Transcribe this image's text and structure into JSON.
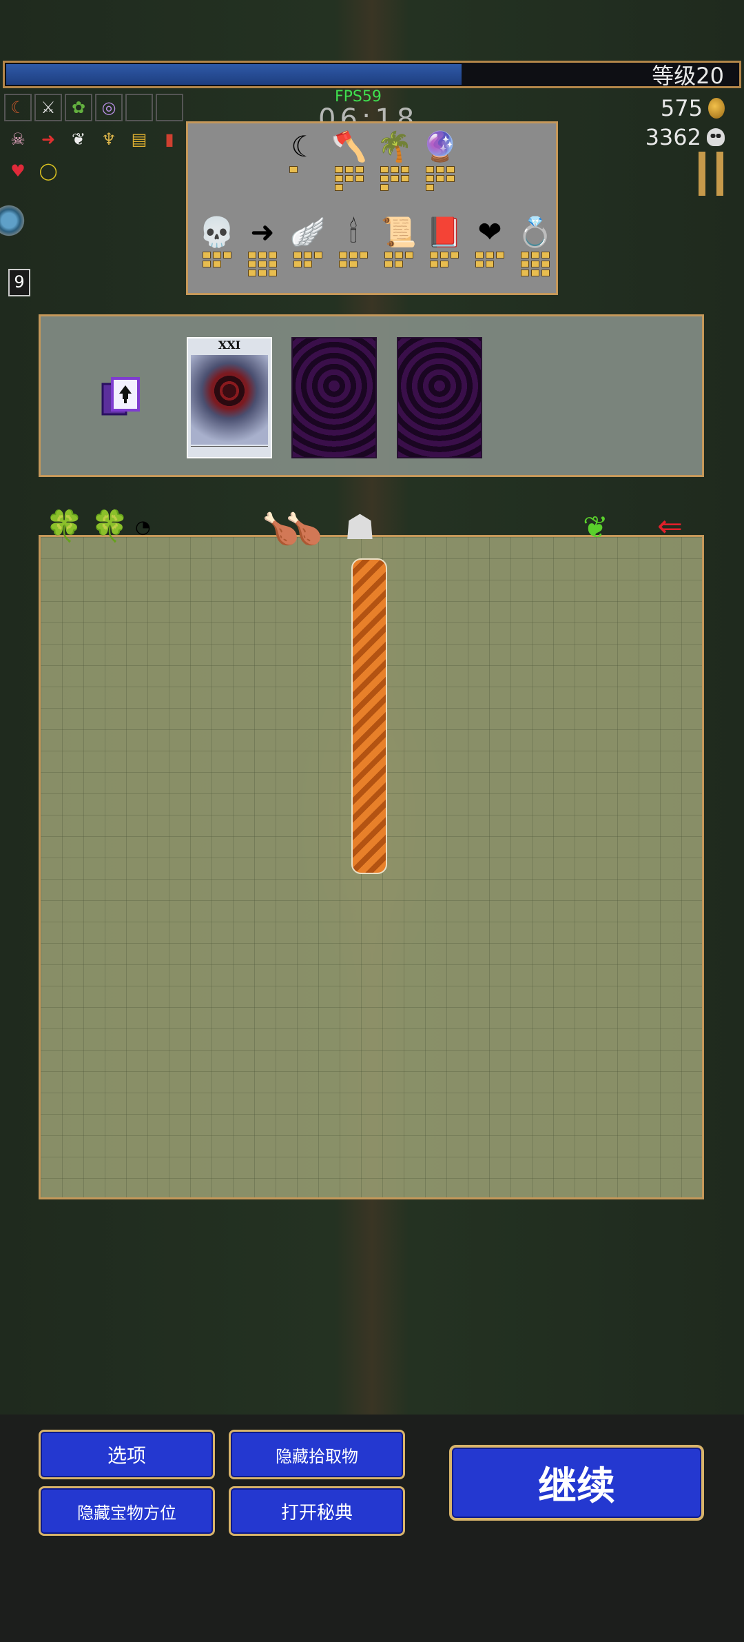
{
  "hud": {
    "level_label": "等级20",
    "xp_fill": 0.62,
    "fps": "FPS59",
    "timer": "06:18",
    "gold": "575",
    "kills": "3362",
    "side_badge": "9"
  },
  "weapon_slots": {
    "row1": [
      "scythe-icon",
      "axe-icon",
      "palm-icon",
      "orb-icon",
      "",
      ""
    ],
    "row2": [
      "skull-icon",
      "arrow-icon",
      "wing-icon",
      "candelabra-icon",
      "tome-icon",
      "bracer-icon"
    ],
    "row3": [
      "heart-icon",
      "ring-icon"
    ]
  },
  "inventory": {
    "weapons": [
      {
        "icon": "scythe-icon",
        "glyph": "☾",
        "level": 1
      },
      {
        "icon": "axe-icon",
        "glyph": "🪓",
        "level": 7
      },
      {
        "icon": "palm-icon",
        "glyph": "🌴",
        "level": 7
      },
      {
        "icon": "orb-icon",
        "glyph": "🔮",
        "level": 7
      }
    ],
    "passives": [
      {
        "icon": "skull-icon",
        "glyph": "💀",
        "level": 5
      },
      {
        "icon": "arrow-icon",
        "glyph": "➜",
        "level": 9
      },
      {
        "icon": "wing-icon",
        "glyph": "🪽",
        "level": 5
      },
      {
        "icon": "candelabra-icon",
        "glyph": "🕯",
        "level": 5
      },
      {
        "icon": "tome-icon",
        "glyph": "📜",
        "level": 5
      },
      {
        "icon": "book-icon",
        "glyph": "📕",
        "level": 5
      },
      {
        "icon": "heart-icon",
        "glyph": "❤",
        "level": 5
      },
      {
        "icon": "ring-icon",
        "glyph": "💍",
        "level": 9
      }
    ]
  },
  "arcana": {
    "card_numeral": "XXI",
    "card_caption": "· · · · · · · · ·",
    "hidden_cards": 2
  },
  "map_pickups": {
    "clovers": [
      "clover-icon",
      "clover-icon"
    ],
    "clover_glyph": "🍀",
    "chicken_glyph": "🍗",
    "feather_glyph": "🪶",
    "magnet_glyph": "🧲"
  },
  "buttons": {
    "options": "选项",
    "hide_pickups": "隐藏拾取物",
    "hide_treasure": "隐藏宝物方位",
    "open_grimoire": "打开秘典",
    "continue": "继续"
  },
  "colors": {
    "xp_blue": "#2f5aa8",
    "frame_gold": "#c5985a",
    "button_blue": "#2438d0"
  }
}
